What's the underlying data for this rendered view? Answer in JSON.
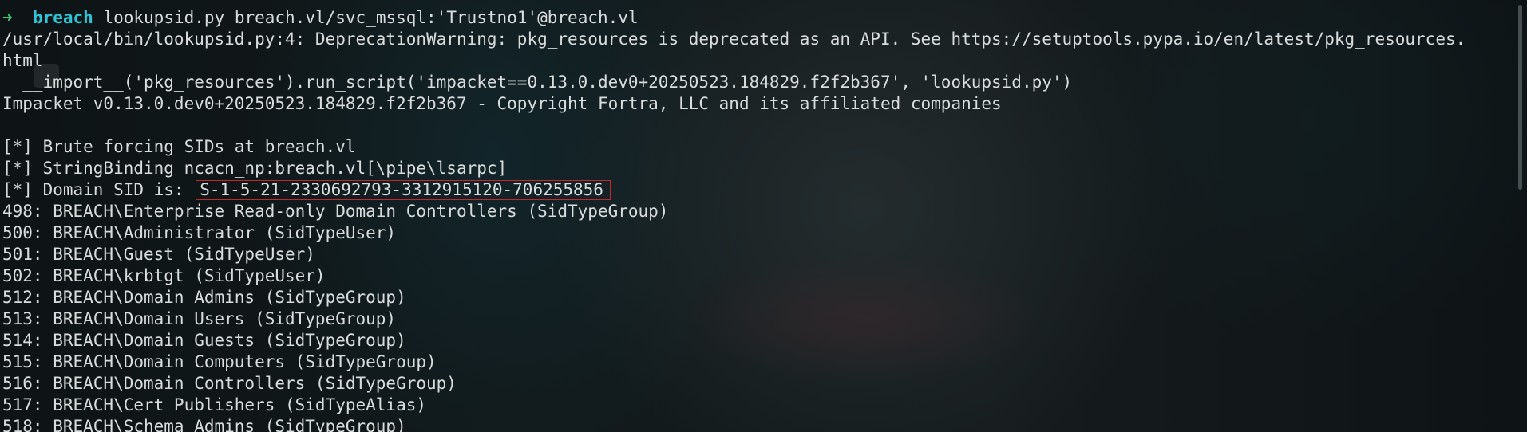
{
  "prompt": {
    "arrow": "➜",
    "dir": "breach",
    "command": "lookupsid.py breach.vl/svc_mssql:'Trustno1'@breach.vl"
  },
  "output": {
    "warning_line1": "/usr/local/bin/lookupsid.py:4: DeprecationWarning: pkg_resources is deprecated as an API. See https://setuptools.pypa.io/en/latest/pkg_resources.",
    "warning_line2": "html",
    "import_line": "  __import__('pkg_resources').run_script('impacket==0.13.0.dev0+20250523.184829.f2f2b367', 'lookupsid.py')",
    "impacket_banner": "Impacket v0.13.0.dev0+20250523.184829.f2f2b367 - Copyright Fortra, LLC and its affiliated companies",
    "brute_line": "[*] Brute forcing SIDs at breach.vl",
    "binding_line": "[*] StringBinding ncacn_np:breach.vl[\\pipe\\lsarpc]",
    "domain_sid_label": "[*] Domain SID is: ",
    "domain_sid_value": "S-1-5-21-2330692793-3312915120-706255856",
    "sid_rows": [
      "498: BREACH\\Enterprise Read-only Domain Controllers (SidTypeGroup)",
      "500: BREACH\\Administrator (SidTypeUser)",
      "501: BREACH\\Guest (SidTypeUser)",
      "502: BREACH\\krbtgt (SidTypeUser)",
      "512: BREACH\\Domain Admins (SidTypeGroup)",
      "513: BREACH\\Domain Users (SidTypeGroup)",
      "514: BREACH\\Domain Guests (SidTypeGroup)",
      "515: BREACH\\Domain Computers (SidTypeGroup)",
      "516: BREACH\\Domain Controllers (SidTypeGroup)",
      "517: BREACH\\Cert Publishers (SidTypeAlias)",
      "518: BREACH\\Schema Admins (SidTypeGroup)"
    ]
  },
  "colors": {
    "prompt_arrow": "#33d17a",
    "prompt_dir": "#2ec4d6",
    "highlight_box": "#c0282b",
    "text": "#d8dcdc"
  }
}
